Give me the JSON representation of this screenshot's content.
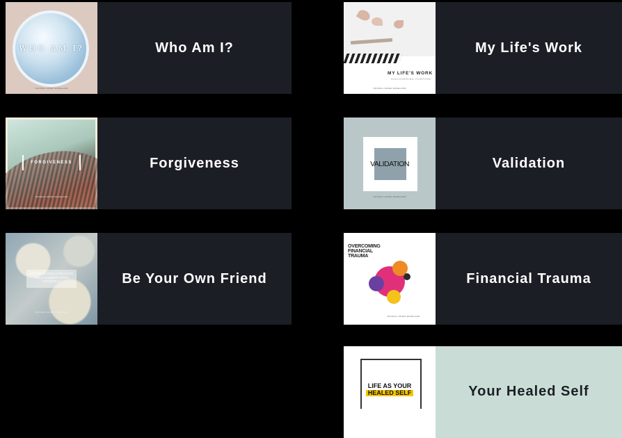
{
  "cards": [
    {
      "title": "Who Am I?",
      "cover_text": "WHO AM I?",
      "byline": "TANISHA JONES WAKELAND"
    },
    {
      "title": "My Life's Work",
      "cover_text": "MY LIFE'S WORK",
      "cover_sub": "DISCOVERING PURPOSE",
      "byline": "TANISHA JONES WAKELAND"
    },
    {
      "title": "Forgiveness",
      "cover_text": "FORGIVENESS",
      "byline": "TANISHA JONES WAKELAND"
    },
    {
      "title": "Validation",
      "cover_text": "VALIDATION",
      "byline": "TANISHA JONES WAKELAND"
    },
    {
      "title": "Be Your Own Friend",
      "cover_text": "ESTABLISHING A HEALTHY RELATIONSHIP WITH YOURSELF",
      "byline": "TANISHA JONES WAKELAND"
    },
    {
      "title": "Financial Trauma",
      "cover_text": "OVERCOMING FINANCIAL TRAUMA",
      "byline": "TANISHA JONES WAKELAND"
    },
    {
      "title": "Your Healed Self",
      "cover_text": "LIFE AS YOUR HEALED SELF"
    }
  ],
  "colors": {
    "page_background": "#000000",
    "card_background": "#1c1e25",
    "highlight_card_background": "#c9ddd6",
    "title_text": "#ffffff"
  }
}
